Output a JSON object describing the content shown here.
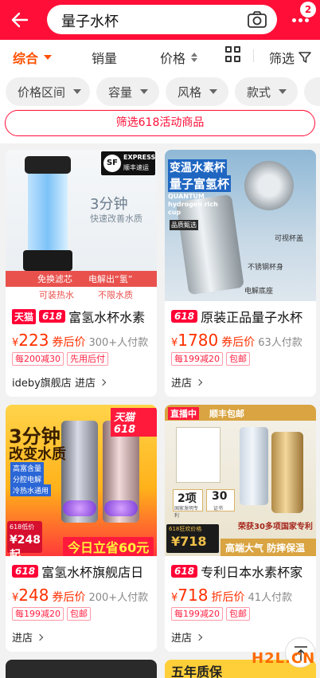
{
  "header": {
    "search_query": "量子水杯",
    "message_count": "2"
  },
  "sortbar": {
    "items": [
      {
        "label": "综合"
      },
      {
        "label": "销量"
      },
      {
        "label": "价格"
      },
      {
        "label": "筛选"
      }
    ]
  },
  "filters": {
    "chips": [
      {
        "label": "价格区间"
      },
      {
        "label": "容量"
      },
      {
        "label": "风格"
      },
      {
        "label": "款式"
      }
    ],
    "promo_label": "筛选618活动商品"
  },
  "products": [
    {
      "tag_tmall": "天猫",
      "tag_618": "618",
      "title": "富氢水杯水素",
      "currency": "¥",
      "price": "223",
      "price_label": "券后价",
      "sales": "300+人付款",
      "badges": [
        "每200减30",
        "先用后付"
      ],
      "shop": "ideby旗舰店 进店",
      "image_texts": {
        "express": "EXPRESS",
        "express_sub": "顺丰速运",
        "sf": "SF",
        "line1": "3分钟",
        "line2": "快速改善水质",
        "banner1": "免换滤芯",
        "banner2": "电解出“氢”",
        "banner3": "可装热水",
        "banner4": "不限水质"
      }
    },
    {
      "tag_618": "618",
      "title": "原装正品量子水杯",
      "currency": "¥",
      "price": "1780",
      "price_label": "券后价",
      "sales": "63人付款",
      "badges": [
        "每199减20",
        "包邮"
      ],
      "shop": "进店",
      "image_texts": {
        "line1": "变温水素杯",
        "line2": "量子富氢杯",
        "line3": "QUANTUM",
        "line4": "hydrogen rich",
        "line5": "cup",
        "callout1": "可视杯盖",
        "callout2": "不锈钢杯身",
        "callout3": "电解底座",
        "badge": "品质甄选"
      }
    },
    {
      "tag_618": "618",
      "title": "富氢水杯旗舰店日",
      "currency": "¥",
      "price": "248",
      "price_label": "券后价",
      "sales": "200+人付款",
      "badges": [
        "每199减20",
        "包邮"
      ],
      "shop": "进店",
      "image_texts": {
        "corner": "天猫618",
        "line1": "3分钟",
        "line2": "改变水质",
        "feat1": "高富含量",
        "feat2": "分腔电解",
        "feat3": "冷热水通用",
        "mini_label": "618低价",
        "mini_price": "¥248起",
        "bottom": "今日立省60元"
      }
    },
    {
      "tag_618": "618",
      "title": "专利日本水素杯家",
      "currency": "¥",
      "price": "718",
      "price_label": "折后价",
      "sales": "41人付款",
      "badges": [
        "每199减20",
        "包邮"
      ],
      "shop": "进店",
      "image_texts": {
        "live": "直播中",
        "shunfeng": "顺丰包邮",
        "cert1": "2项",
        "cert1_sub": "国家发明专利",
        "cert2": "30",
        "cert2_sub": "证书",
        "award": "荣获30多项国家专利",
        "low": "618狂欢价格",
        "low_price": "¥718",
        "slogan": "高端大气 防摔保温"
      }
    }
  ],
  "footer_images": {
    "right_text": "五年质保"
  },
  "watermark": "H2L.CN"
}
